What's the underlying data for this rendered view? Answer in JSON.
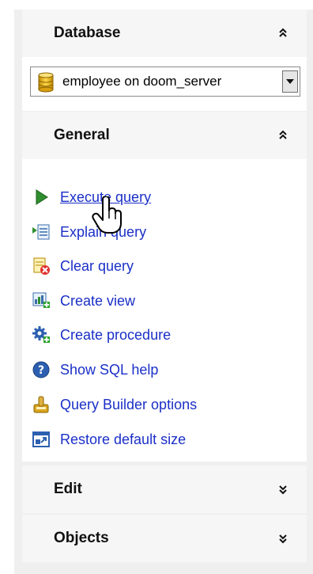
{
  "database_section": {
    "title": "Database",
    "selected_database": "employee on doom_server",
    "collapse_icon": "chevron-double-up-icon"
  },
  "general_section": {
    "title": "General",
    "collapse_icon": "chevron-double-up-icon",
    "items": [
      {
        "label": "Execute query",
        "icon": "play-icon"
      },
      {
        "label": "Explain query",
        "icon": "explain-plan-icon"
      },
      {
        "label": "Clear query",
        "icon": "clear-document-icon"
      },
      {
        "label": "Create view",
        "icon": "create-view-icon"
      },
      {
        "label": "Create procedure",
        "icon": "gear-plus-icon"
      },
      {
        "label": "Show SQL help",
        "icon": "help-icon"
      },
      {
        "label": "Query Builder options",
        "icon": "options-icon"
      },
      {
        "label": "Restore default size",
        "icon": "restore-size-icon"
      }
    ]
  },
  "edit_section": {
    "title": "Edit",
    "expand_icon": "chevron-double-down-icon"
  },
  "objects_section": {
    "title": "Objects",
    "expand_icon": "chevron-double-down-icon"
  },
  "colors": {
    "link": "#1a2fc7",
    "panel_bg": "#efefef",
    "header_bg": "#f6f6f6"
  }
}
